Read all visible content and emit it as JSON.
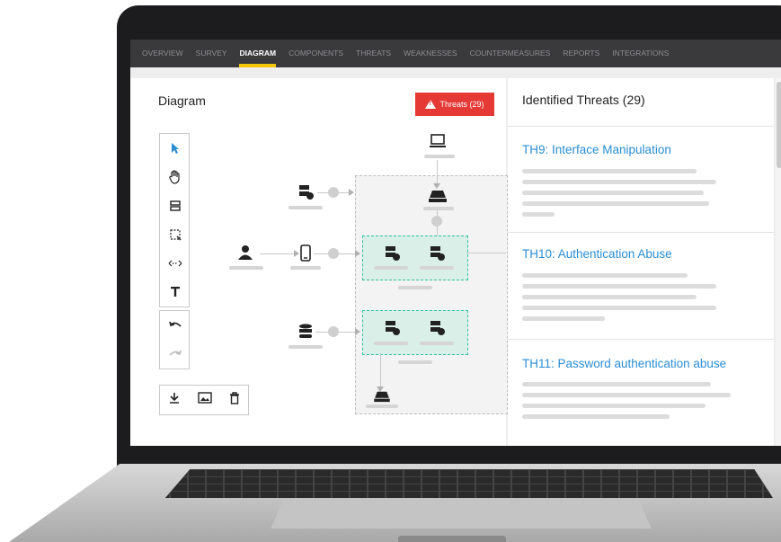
{
  "nav": {
    "tabs": [
      "OVERVIEW",
      "SURVEY",
      "DIAGRAM",
      "COMPONENTS",
      "THREATS",
      "WEAKNESSES",
      "COUNTERMEASURES",
      "REPORTS",
      "INTEGRATIONS"
    ],
    "active": "DIAGRAM"
  },
  "diagram": {
    "title": "Diagram",
    "threats_button": "Threats (29)"
  },
  "toolbar": {
    "tools": [
      "pointer-icon",
      "hand-icon",
      "server-icon",
      "select-region-icon",
      "connector-icon",
      "text-icon"
    ],
    "history": [
      "undo-icon",
      "redo-icon"
    ],
    "bottom": [
      "download-icon",
      "image-icon",
      "trash-icon"
    ]
  },
  "threats_panel": {
    "title": "Identified Threats (29)",
    "items": [
      {
        "label": "TH9: Interface Manipulation"
      },
      {
        "label": "TH10: Authentication Abuse"
      },
      {
        "label": "TH11: Password authentication abuse"
      }
    ]
  },
  "colors": {
    "accent": "#f5c400",
    "danger": "#e53935",
    "link": "#2a8dd4",
    "group": "#2ec4a0"
  }
}
